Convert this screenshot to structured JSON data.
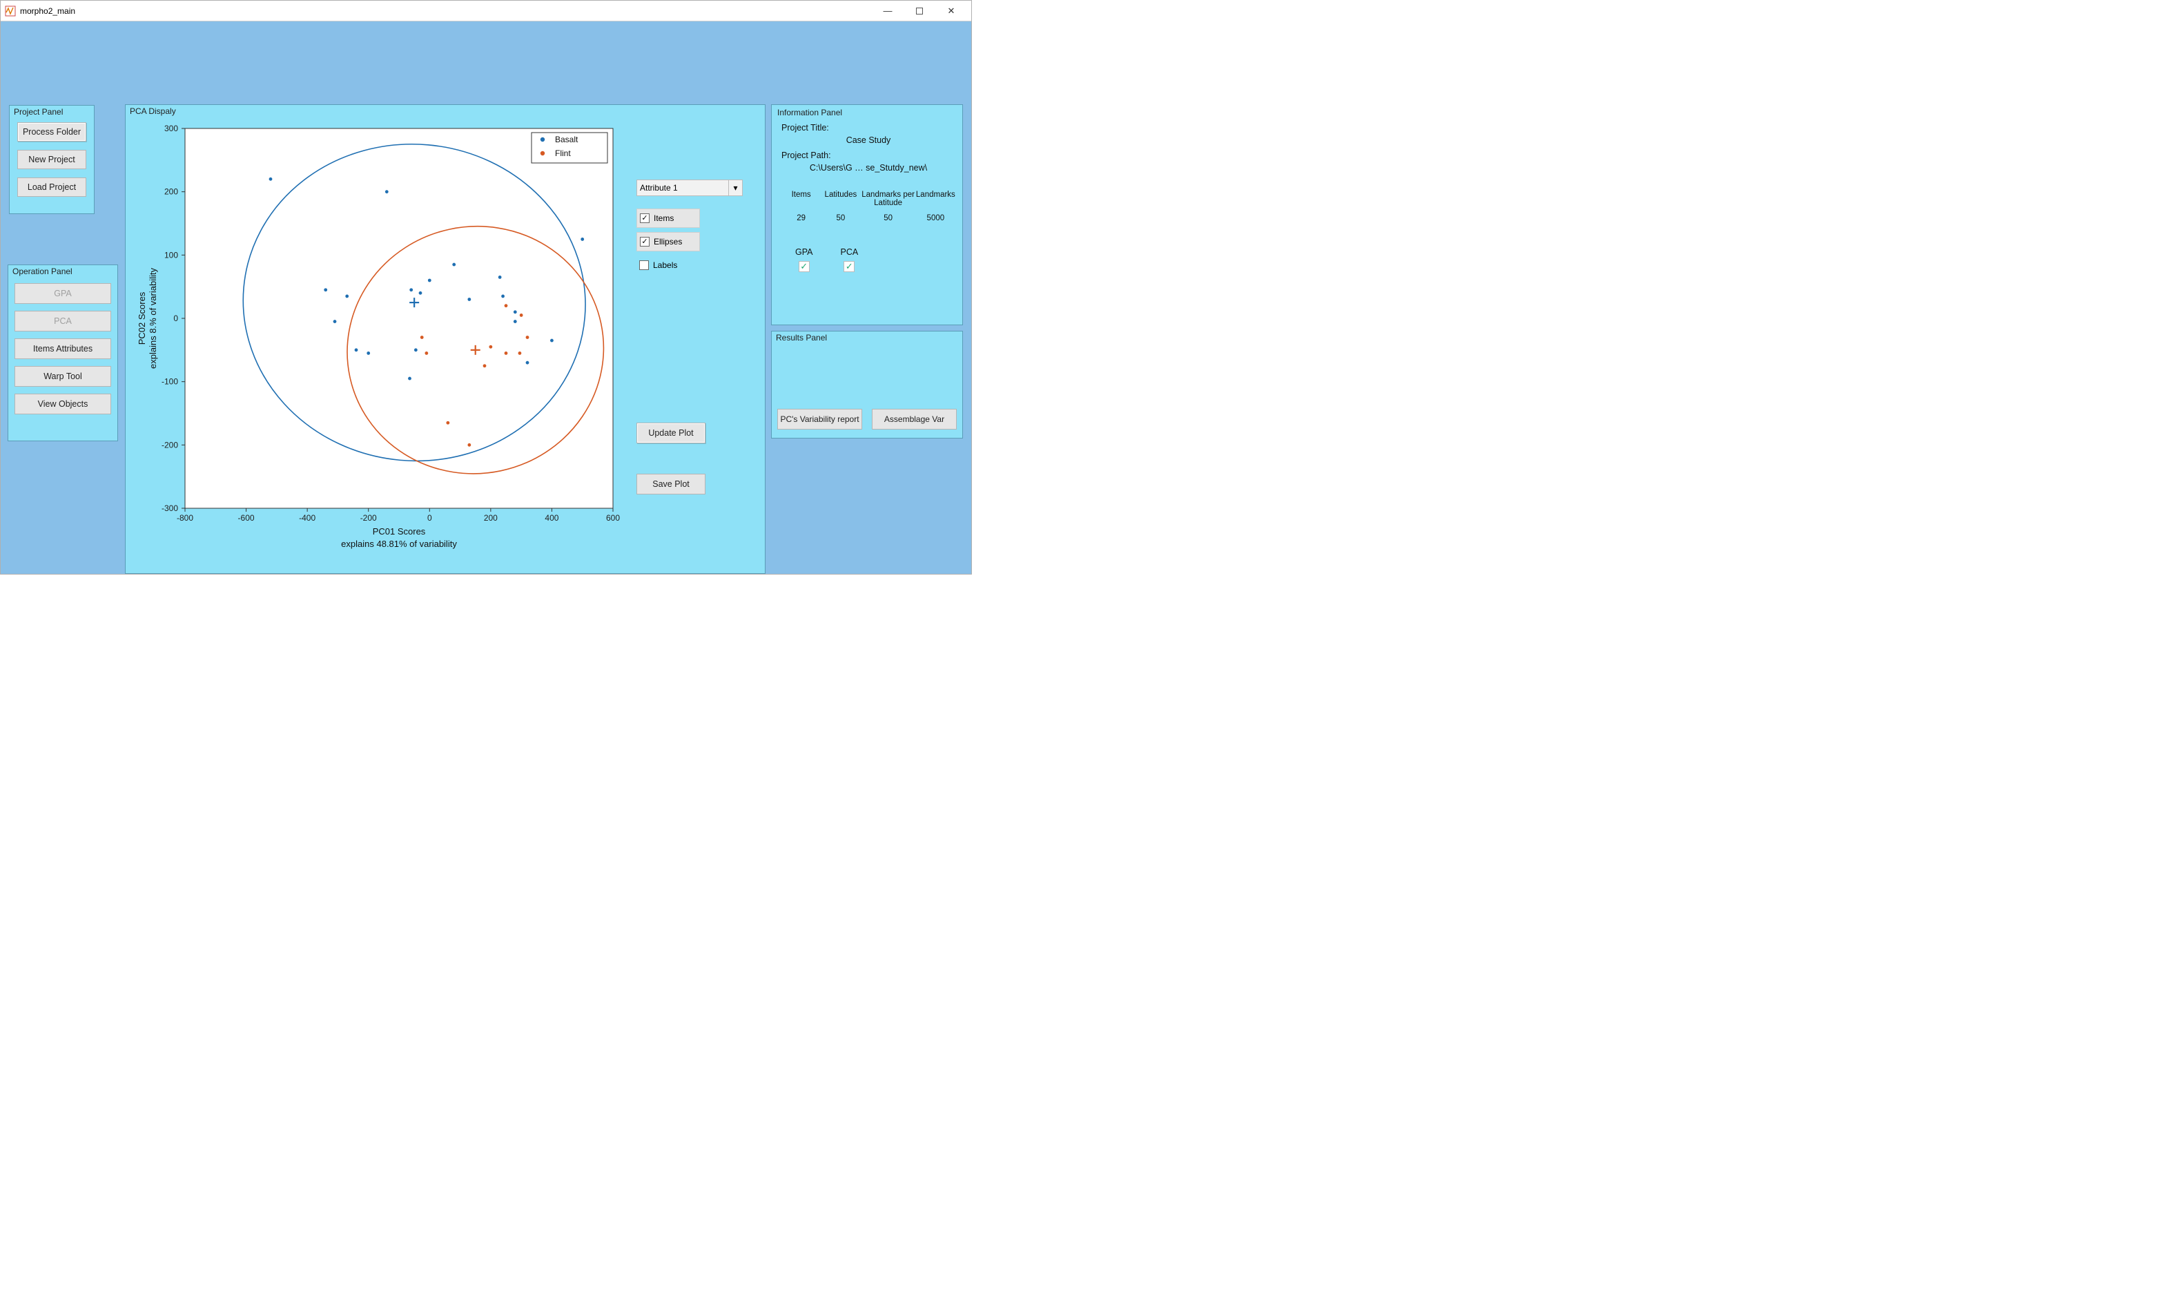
{
  "window": {
    "title": "morpho2_main"
  },
  "project_panel": {
    "title": "Project Panel",
    "process_folder": "Process Folder",
    "new_project": "New Project",
    "load_project": "Load Project"
  },
  "operation_panel": {
    "title": "Operation Panel",
    "gpa": "GPA",
    "pca": "PCA",
    "items_attributes": "Items Attributes",
    "warp_tool": "Warp Tool",
    "view_objects": "View Objects"
  },
  "pca_panel": {
    "title": "PCA Dispaly",
    "attribute_selected": "Attribute 1",
    "chk_items": "Items",
    "chk_ellipses": "Ellipses",
    "chk_labels": "Labels",
    "update_plot": "Update Plot",
    "save_plot": "Save Plot",
    "legend": {
      "a": "Basalt",
      "b": "Flint"
    },
    "xlabel_line1": "PC01 Scores",
    "xlabel_line2": "explains 48.81% of variability",
    "ylabel_line1": "PC02 Scores",
    "ylabel_line2": "explains 8.% of variability"
  },
  "info_panel": {
    "title": "Information Panel",
    "project_title_label": "Project Title:",
    "project_title_value": "Case Study",
    "project_path_label": "Project Path:",
    "project_path_value": "C:\\Users\\G … se_Stutdy_new\\",
    "cols": {
      "items": "Items",
      "lat": "Latitudes",
      "lpl": "Landmarks per Latitude",
      "lm": "Landmarks"
    },
    "vals": {
      "items": "29",
      "lat": "50",
      "lpl": "50",
      "lm": "5000"
    },
    "gpa": "GPA",
    "pca": "PCA"
  },
  "results_panel": {
    "title": "Results Panel",
    "pcs_report": "PC's Variability report",
    "assemblage_var": "Assemblage Var"
  },
  "chart_data": {
    "type": "scatter",
    "xlabel": "PC01 Scores — explains 48.81% of variability",
    "ylabel": "PC02 Scores — explains 8.% of variability",
    "xlim": [
      -800,
      600
    ],
    "ylim": [
      -300,
      300
    ],
    "xticks": [
      -800,
      -600,
      -400,
      -200,
      0,
      200,
      400,
      600
    ],
    "yticks": [
      -300,
      -200,
      -100,
      0,
      100,
      200,
      300
    ],
    "legend": [
      "Basalt",
      "Flint"
    ],
    "series": [
      {
        "name": "Basalt",
        "color": "#1f6fb2",
        "centroid": [
          -50,
          25
        ],
        "ellipse": {
          "cx": -50,
          "cy": 25,
          "rx": 560,
          "ry": 250,
          "rot_deg": -5
        },
        "points": [
          [
            -520,
            220
          ],
          [
            -140,
            200
          ],
          [
            -340,
            45
          ],
          [
            -270,
            35
          ],
          [
            -310,
            -5
          ],
          [
            -60,
            45
          ],
          [
            -30,
            40
          ],
          [
            0,
            60
          ],
          [
            80,
            85
          ],
          [
            130,
            30
          ],
          [
            230,
            65
          ],
          [
            240,
            35
          ],
          [
            280,
            10
          ],
          [
            280,
            -5
          ],
          [
            500,
            125
          ],
          [
            -200,
            -55
          ],
          [
            -240,
            -50
          ],
          [
            -45,
            -50
          ],
          [
            -65,
            -95
          ],
          [
            320,
            -70
          ],
          [
            400,
            -35
          ]
        ]
      },
      {
        "name": "Flint",
        "color": "#d65a23",
        "centroid": [
          150,
          -50
        ],
        "ellipse": {
          "cx": 150,
          "cy": -50,
          "rx": 420,
          "ry": 195,
          "rot_deg": 12
        },
        "points": [
          [
            250,
            20
          ],
          [
            300,
            5
          ],
          [
            200,
            -45
          ],
          [
            250,
            -55
          ],
          [
            295,
            -55
          ],
          [
            320,
            -30
          ],
          [
            -25,
            -30
          ],
          [
            -10,
            -55
          ],
          [
            60,
            -165
          ],
          [
            130,
            -200
          ],
          [
            180,
            -75
          ]
        ]
      }
    ]
  }
}
